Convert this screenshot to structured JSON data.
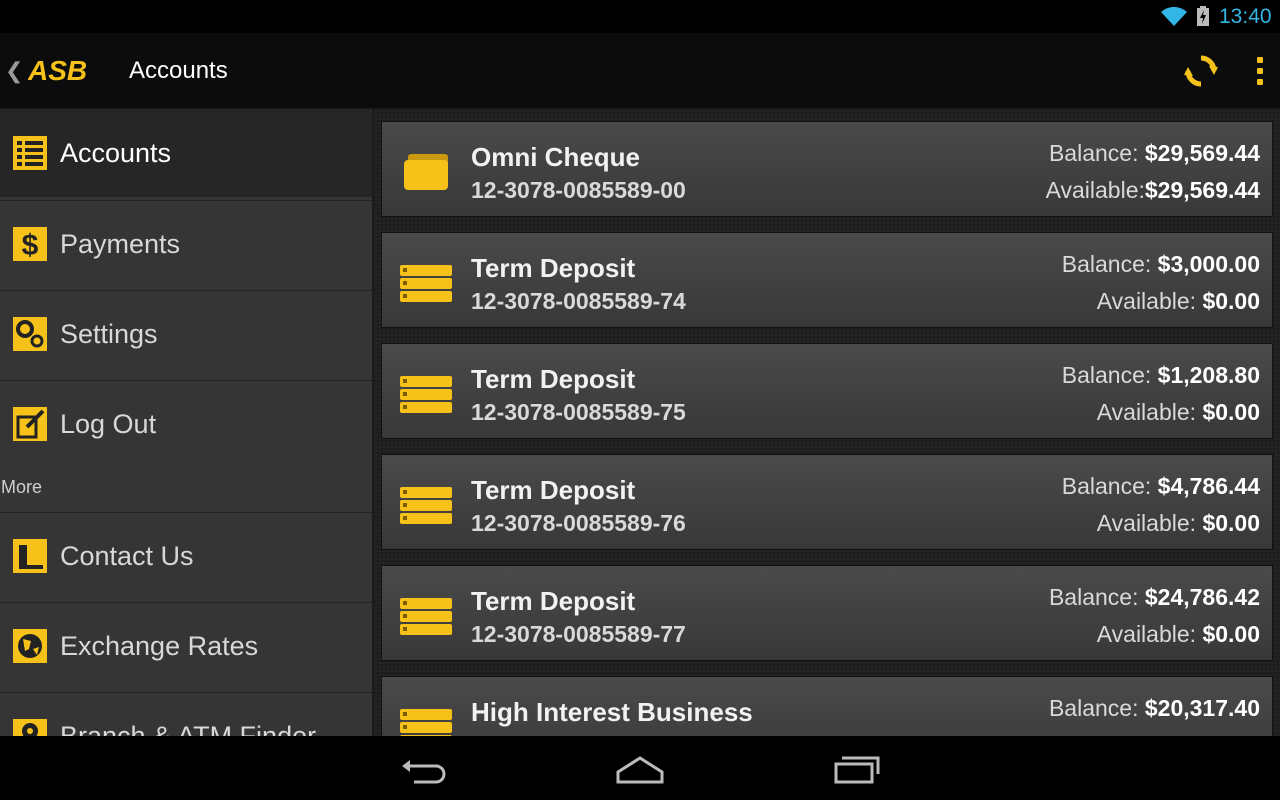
{
  "status": {
    "time": "13:40",
    "accent": "#33b5e5"
  },
  "header": {
    "brand": "ASB",
    "title": "Accounts",
    "accent": "#f6c21a",
    "icons": [
      "back-chevron-icon",
      "refresh-icon",
      "overflow-menu-icon"
    ]
  },
  "sidebar": {
    "items": [
      {
        "label": "Accounts",
        "icon": "list-icon"
      },
      {
        "label": "Payments",
        "icon": "dollar-icon"
      },
      {
        "label": "Settings",
        "icon": "gears-icon"
      },
      {
        "label": "Log Out",
        "icon": "logout-icon"
      }
    ],
    "more_label": "More",
    "more_items": [
      {
        "label": "Contact Us",
        "icon": "phone-icon"
      },
      {
        "label": "Exchange Rates",
        "icon": "globe-icon"
      },
      {
        "label": "Branch & ATM Finder",
        "icon": "location-pin-icon"
      }
    ]
  },
  "accounts": [
    {
      "name": "Omni Cheque",
      "number": "12-3078-0085589-00",
      "balance_label": "Balance:",
      "balance": "$29,569.44",
      "available_label": "Available:",
      "available": "$29,569.44",
      "icon": "wallet-icon"
    },
    {
      "name": "Term Deposit",
      "number": "12-3078-0085589-74",
      "balance_label": "Balance:",
      "balance": "$3,000.00",
      "available_label": "Available:",
      "available": "$0.00",
      "icon": "stack-icon"
    },
    {
      "name": "Term Deposit",
      "number": "12-3078-0085589-75",
      "balance_label": "Balance:",
      "balance": "$1,208.80",
      "available_label": "Available:",
      "available": "$0.00",
      "icon": "stack-icon"
    },
    {
      "name": "Term Deposit",
      "number": "12-3078-0085589-76",
      "balance_label": "Balance:",
      "balance": "$4,786.44",
      "available_label": "Available:",
      "available": "$0.00",
      "icon": "stack-icon"
    },
    {
      "name": "Term Deposit",
      "number": "12-3078-0085589-77",
      "balance_label": "Balance:",
      "balance": "$24,786.42",
      "available_label": "Available:",
      "available": "$0.00",
      "icon": "stack-icon"
    },
    {
      "name": "High Interest Business",
      "number": "",
      "balance_label": "Balance:",
      "balance": "$20,317.40",
      "available_label": "",
      "available": "",
      "icon": "stack-icon"
    }
  ],
  "system_nav": {
    "icons": [
      "back-icon",
      "home-icon",
      "recent-apps-icon"
    ]
  }
}
